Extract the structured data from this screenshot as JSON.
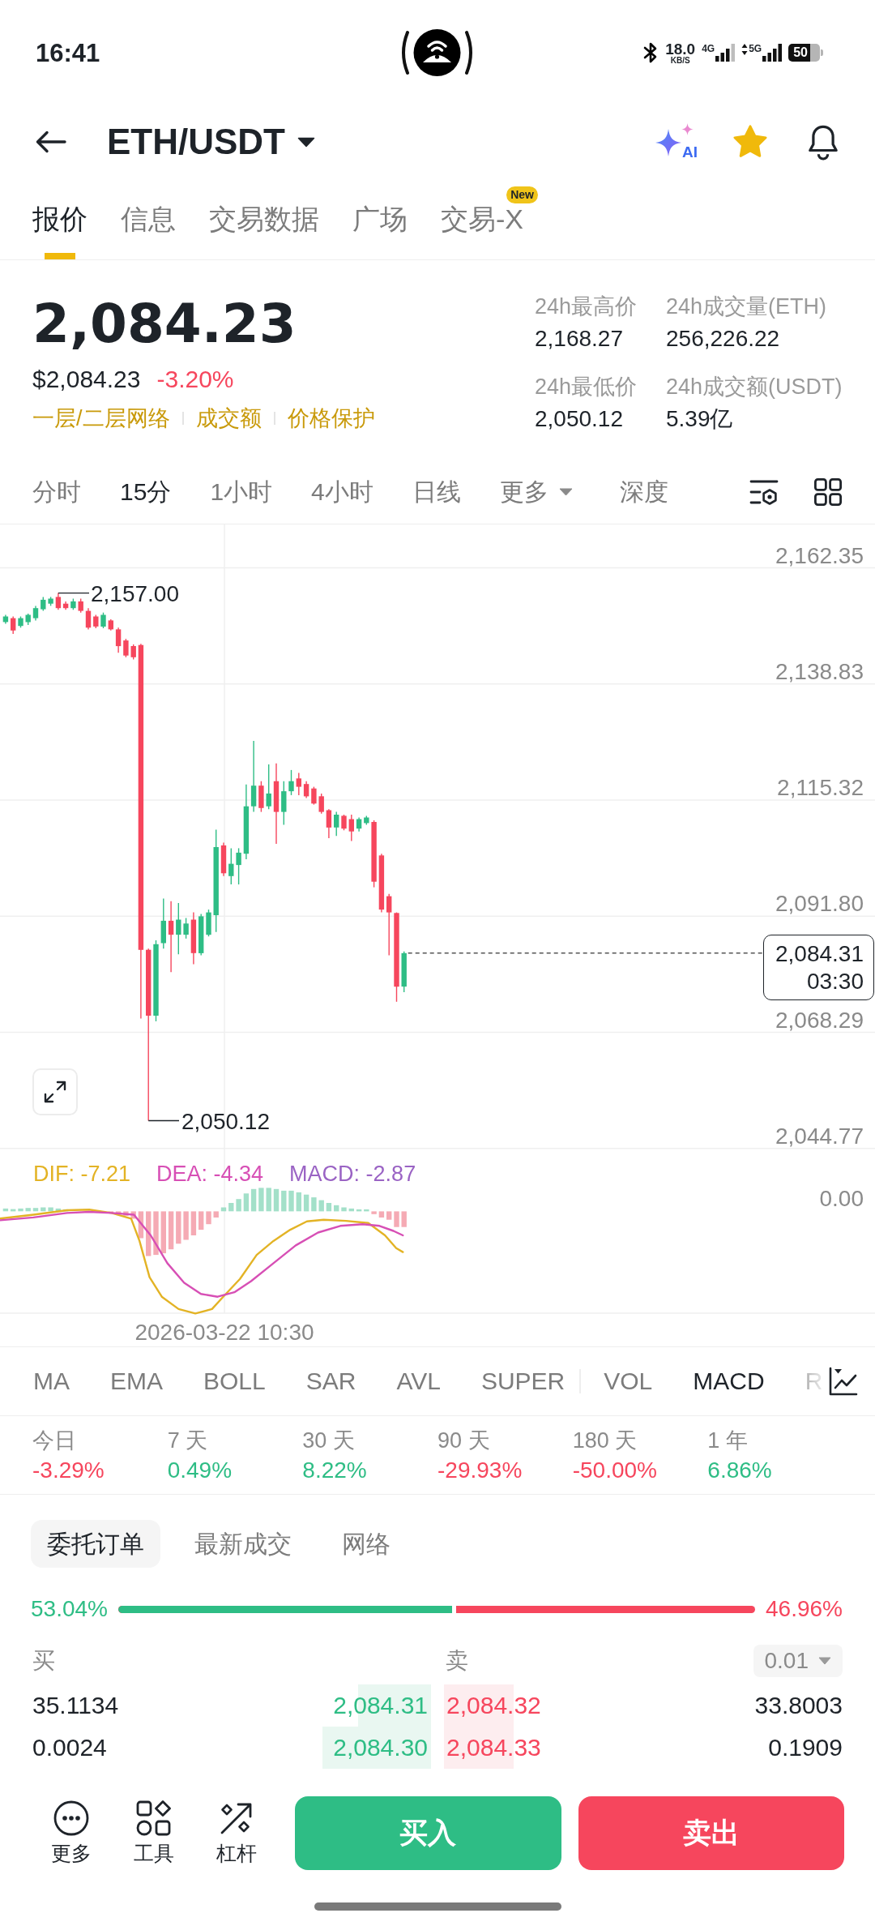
{
  "status_bar": {
    "time": "16:41",
    "network_speed": "18.0",
    "speed_unit": "KB/S",
    "sim_1": "4G",
    "sim_2": "5G",
    "battery": "50"
  },
  "header": {
    "pair": "ETH/USDT",
    "ai_label": "AI",
    "favorited": true
  },
  "tabs": [
    {
      "label": "报价",
      "selected": true
    },
    {
      "label": "信息",
      "selected": false
    },
    {
      "label": "交易数据",
      "selected": false
    },
    {
      "label": "广场",
      "selected": false
    },
    {
      "label": "交易-X",
      "selected": false,
      "badge": "New"
    }
  ],
  "price": {
    "last": "2,084.23",
    "fiat": "$2,084.23",
    "change": {
      "text": "-3.20%",
      "color": "#f6465d"
    },
    "links": [
      "一层/二层网络",
      "成交额",
      "价格保护"
    ]
  },
  "stats": [
    {
      "label": "24h最高价",
      "value": "2,168.27"
    },
    {
      "label": "24h成交量(ETH)",
      "value": "256,226.22"
    },
    {
      "label": "24h最低价",
      "value": "2,050.12"
    },
    {
      "label": "24h成交额(USDT)",
      "value": "5.39亿"
    }
  ],
  "intervals": [
    {
      "label": "分时",
      "selected": false,
      "dropdown": false
    },
    {
      "label": "15分",
      "selected": true,
      "dropdown": false
    },
    {
      "label": "1小时",
      "selected": false,
      "dropdown": false
    },
    {
      "label": "4小时",
      "selected": false,
      "dropdown": false
    },
    {
      "label": "日线",
      "selected": false,
      "dropdown": false
    },
    {
      "label": "更多",
      "selected": false,
      "dropdown": true
    },
    {
      "label": "深度",
      "selected": false,
      "dropdown": false
    }
  ],
  "chart": {
    "price_axis": [
      "2,162.35",
      "2,138.83",
      "2,115.32",
      "2,091.80",
      "2,068.29",
      "2,044.77"
    ],
    "high_label": "2,157.00",
    "low_label": "2,050.12",
    "last_price": "2,084.31",
    "countdown": "03:30",
    "macd_legend": [
      {
        "text": "DIF: -7.21",
        "color": "#e3b325"
      },
      {
        "text": "DEA: -4.34",
        "color": "#d74fb5"
      },
      {
        "text": "MACD: -2.87",
        "color": "#9a63c4"
      }
    ],
    "macd_axis": "0.00",
    "time_label": "2026-03-22 10:30"
  },
  "indicators": {
    "main": [
      {
        "label": "MA",
        "selected": false
      },
      {
        "label": "EMA",
        "selected": false
      },
      {
        "label": "BOLL",
        "selected": false
      },
      {
        "label": "SAR",
        "selected": false
      },
      {
        "label": "AVL",
        "selected": false
      },
      {
        "label": "SUPER",
        "selected": false
      }
    ],
    "sub": [
      {
        "label": "VOL",
        "selected": false
      },
      {
        "label": "MACD",
        "selected": true
      },
      {
        "label": "R",
        "selected": false
      }
    ]
  },
  "performance": [
    {
      "period": "今日",
      "change": "-3.29%",
      "color": "#f6465d"
    },
    {
      "period": "7 天",
      "change": "0.49%",
      "color": "#2ebd85"
    },
    {
      "period": "30 天",
      "change": "8.22%",
      "color": "#2ebd85"
    },
    {
      "period": "90 天",
      "change": "-29.93%",
      "color": "#f6465d"
    },
    {
      "period": "180 天",
      "change": "-50.00%",
      "color": "#f6465d"
    },
    {
      "period": "1 年",
      "change": "6.86%",
      "color": "#2ebd85"
    }
  ],
  "order_tabs": [
    {
      "label": "委托订单",
      "selected": true
    },
    {
      "label": "最新成交",
      "selected": false
    },
    {
      "label": "网络",
      "selected": false
    }
  ],
  "order_book": {
    "buy_share": "53.04%",
    "sell_share": "46.96%",
    "ratio": {
      "level": 0.5304
    },
    "buy_heading": "买",
    "sell_heading": "卖",
    "precision": "0.01",
    "rows": [
      {
        "bid_quantity": "35.1134",
        "bid_price": "2,084.31",
        "ask_price": "2,084.32",
        "ask_quantity": "33.8003"
      },
      {
        "bid_quantity": "0.0024",
        "bid_price": "2,084.30",
        "ask_price": "2,084.33",
        "ask_quantity": "0.1909"
      }
    ]
  },
  "actions": {
    "tools": [
      {
        "label": "更多",
        "kind": "more"
      },
      {
        "label": "工具",
        "kind": "tools"
      },
      {
        "label": "杠杆",
        "kind": "leverage"
      }
    ],
    "buy": "买入",
    "sell": "卖出"
  }
}
